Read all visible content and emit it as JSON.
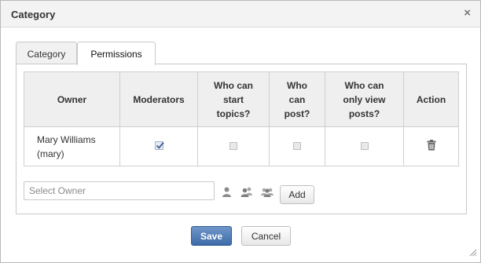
{
  "dialog": {
    "title": "Category",
    "close_symbol": "×"
  },
  "tabs": [
    {
      "label": "Category",
      "active": false
    },
    {
      "label": "Permissions",
      "active": true
    }
  ],
  "table": {
    "headers": {
      "owner": "Owner",
      "moderators": "Moderators",
      "start_topics": [
        "Who can",
        "start",
        "topics?"
      ],
      "post": [
        "Who",
        "can",
        "post?"
      ],
      "view_only": [
        "Who can",
        "only view",
        "posts?"
      ],
      "action": "Action"
    },
    "rows": [
      {
        "owner_name": "Mary Williams",
        "owner_username": "(mary)",
        "moderator": true,
        "start_topics": false,
        "post": false,
        "view_only": false,
        "action_icon": "trash-icon"
      }
    ]
  },
  "owner_picker": {
    "placeholder": "Select Owner",
    "value": "",
    "icons": [
      "user-icon",
      "group-icon",
      "group-icon"
    ],
    "add_label": "Add"
  },
  "footer": {
    "save_label": "Save",
    "cancel_label": "Cancel"
  },
  "colors": {
    "primary_button": "#4a74ad",
    "header_bg": "#efefef",
    "title_bar_bg": "#f3f3f3"
  }
}
